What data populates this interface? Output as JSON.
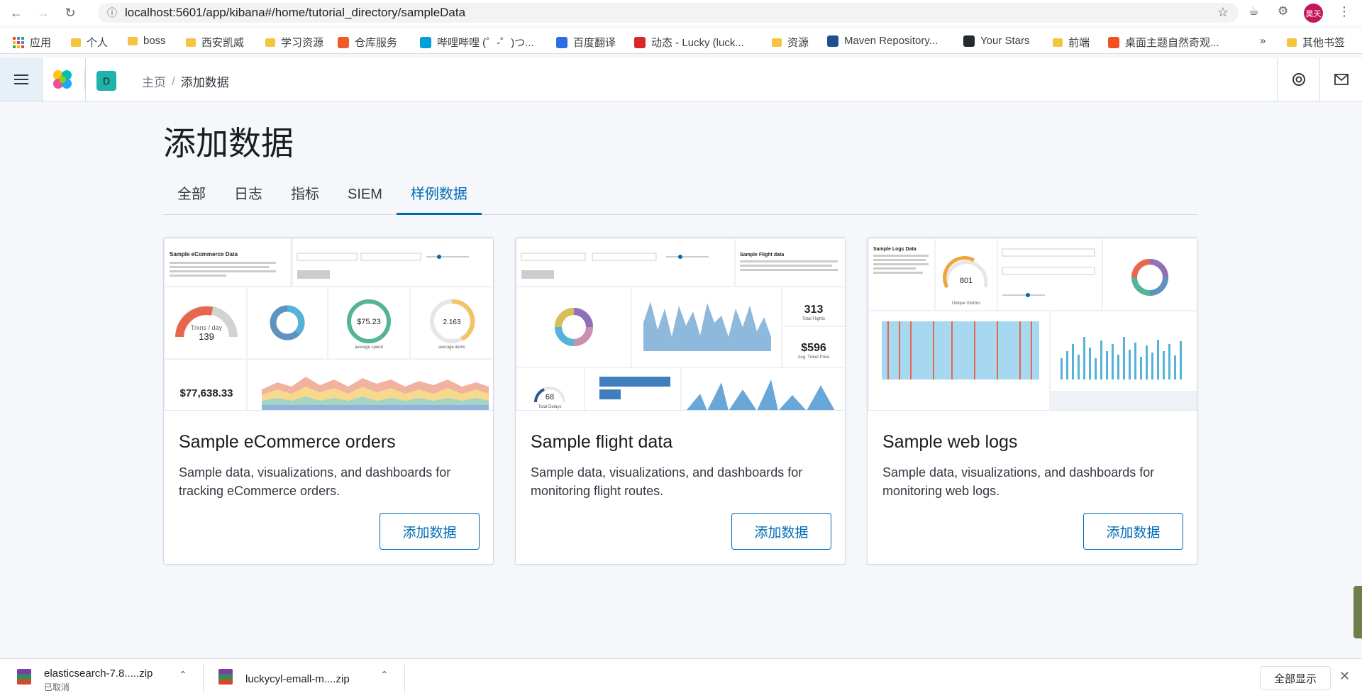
{
  "browser": {
    "url": "localhost:5601/app/kibana#/home/tutorial_directory/sampleData",
    "profile_label": "昊天"
  },
  "bookmarks": {
    "items": [
      {
        "label": "应用",
        "kind": "apps"
      },
      {
        "label": "个人",
        "kind": "folder"
      },
      {
        "label": "boss",
        "kind": "folder"
      },
      {
        "label": "西安凯威",
        "kind": "folder"
      },
      {
        "label": "学习资源",
        "kind": "folder"
      },
      {
        "label": "仓库服务",
        "kind": "site",
        "color": "#f05a28"
      },
      {
        "label": "哔哩哔哩 (゜-゜)つ...",
        "kind": "site",
        "color": "#00a1d6"
      },
      {
        "label": "百度翻译",
        "kind": "site",
        "color": "#2b6de5"
      },
      {
        "label": "动态 - Lucky (luck...",
        "kind": "site",
        "color": "#d9262c"
      },
      {
        "label": "资源",
        "kind": "folder"
      },
      {
        "label": "Maven Repository...",
        "kind": "site",
        "color": "#1d4f91"
      },
      {
        "label": "Your Stars",
        "kind": "site",
        "color": "#24292e"
      },
      {
        "label": "前端",
        "kind": "folder"
      },
      {
        "label": "桌面主题自然奇观...",
        "kind": "site",
        "color": "#f25022"
      }
    ],
    "overflow": "»",
    "other": "其他书签"
  },
  "kibana": {
    "space_initial": "D",
    "breadcrumb": {
      "home": "主页",
      "current": "添加数据"
    }
  },
  "page": {
    "title": "添加数据",
    "tabs": [
      {
        "label": "全部",
        "active": false
      },
      {
        "label": "日志",
        "active": false
      },
      {
        "label": "指标",
        "active": false
      },
      {
        "label": "SIEM",
        "active": false
      },
      {
        "label": "样例数据",
        "active": true
      }
    ],
    "cards": [
      {
        "title": "Sample eCommerce orders",
        "description": "Sample data, visualizations, and dashboards for tracking eCommerce orders.",
        "button": "添加数据",
        "thumb": {
          "heading": "Sample eCommerce Data",
          "gauge_label": "Trxns / day",
          "gauge_value": "139",
          "avg_spend": "$75.23",
          "avg_spend_caption": "average spend",
          "avg_items": "2.163",
          "avg_items_caption": "average items",
          "revenue": "$77,638.33"
        }
      },
      {
        "title": "Sample flight data",
        "description": "Sample data, visualizations, and dashboards for monitoring flight routes.",
        "button": "添加数据",
        "thumb": {
          "heading": "Sample Flight data",
          "total_flights": "313",
          "total_flights_caption": "Total Flights",
          "avg_price": "$596",
          "avg_price_caption": "Avg. Ticket Price",
          "delays": "68",
          "delays_caption": "Total Delays"
        }
      },
      {
        "title": "Sample web logs",
        "description": "Sample data, visualizations, and dashboards for monitoring web logs.",
        "button": "添加数据",
        "thumb": {
          "heading": "Sample Logs Data",
          "visitors": "801",
          "visitors_caption": "Unique Visitors"
        }
      }
    ]
  },
  "downloads": {
    "items": [
      {
        "name": "elasticsearch-7.8.....zip",
        "status": "已取消"
      },
      {
        "name": "luckycyl-emall-m....zip",
        "status": ""
      }
    ],
    "show_all": "全部显示"
  },
  "colors": {
    "accent": "#006bb4",
    "gauge_red": "#e7664c",
    "teal": "#54b399",
    "blue": "#6092c0",
    "purple": "#9170b8",
    "yellow": "#d6bf57",
    "pink": "#ca8eae"
  }
}
